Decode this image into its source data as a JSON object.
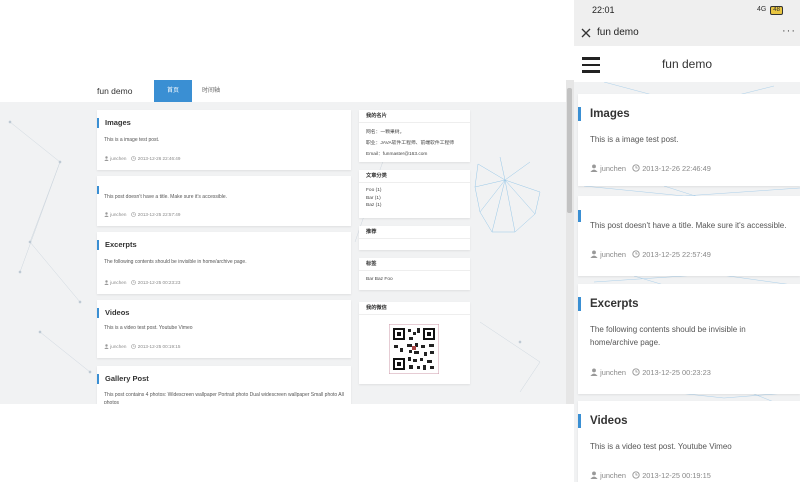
{
  "desktop": {
    "site_title": "fun demo",
    "nav": [
      {
        "label": "首页",
        "active": true
      },
      {
        "label": "时间轴",
        "active": false
      }
    ],
    "posts": [
      {
        "title": "Images",
        "excerpt": "This is a image test post.",
        "author": "junchen",
        "date": "2013-12-26 22:46:49"
      },
      {
        "title": "",
        "excerpt": "This post doesn’t have a title. Make sure it’s accessible.",
        "author": "junchen",
        "date": "2013-12-25 22:57:49"
      },
      {
        "title": "Excerpts",
        "excerpt": "The following contents should be invisible in home/archive page.",
        "author": "junchen",
        "date": "2013-12-25 00:23:23"
      },
      {
        "title": "Videos",
        "excerpt": "This is a video test post. Youtube Vimeo",
        "author": "junchen",
        "date": "2013-12-25 00:19:15"
      },
      {
        "title": "Gallery Post",
        "excerpt": "This post contains 4 photos: Widescreen wallpaper Portrait photo Dual widescreen wallpaper Small photo All photos"
      }
    ],
    "sidebar": {
      "card_title": "我的名片",
      "card_lines": [
        "网名：一颗果树。",
        "职业：JAVA软件工程师、前端软件工程师",
        "Email：funmaster@163.com"
      ],
      "categories_title": "文章分类",
      "categories": [
        "Foo (1)",
        "Bar (1)",
        "Baz (1)"
      ],
      "recommend_title": "推荐",
      "tags_title": "标签",
      "tags": "Bar Baz Foo",
      "wechat_title": "我的微信"
    }
  },
  "mobile": {
    "status": {
      "time": "22:01",
      "signal": "4G",
      "battery": "48"
    },
    "titlebar": {
      "title": "fun demo",
      "more": "···"
    },
    "site_title": "fun demo",
    "posts": [
      {
        "title": "Images",
        "excerpt": "This is a image test post.",
        "author": "junchen",
        "date": "2013-12-26 22:46:49"
      },
      {
        "title": "",
        "excerpt": "This post doesn't have a title. Make sure it's accessible.",
        "author": "junchen",
        "date": "2013-12-25 22:57:49"
      },
      {
        "title": "Excerpts",
        "excerpt": "The following contents should be invisible in home/archive page.",
        "author": "junchen",
        "date": "2013-12-25 00:23:23"
      },
      {
        "title": "Videos",
        "excerpt": "This is a video test post. Youtube Vimeo",
        "author": "junchen",
        "date": "2013-12-25 00:19:15"
      }
    ]
  },
  "colors": {
    "accent": "#3a8fd3",
    "background": "#f1f2f3",
    "card": "#ffffff"
  }
}
